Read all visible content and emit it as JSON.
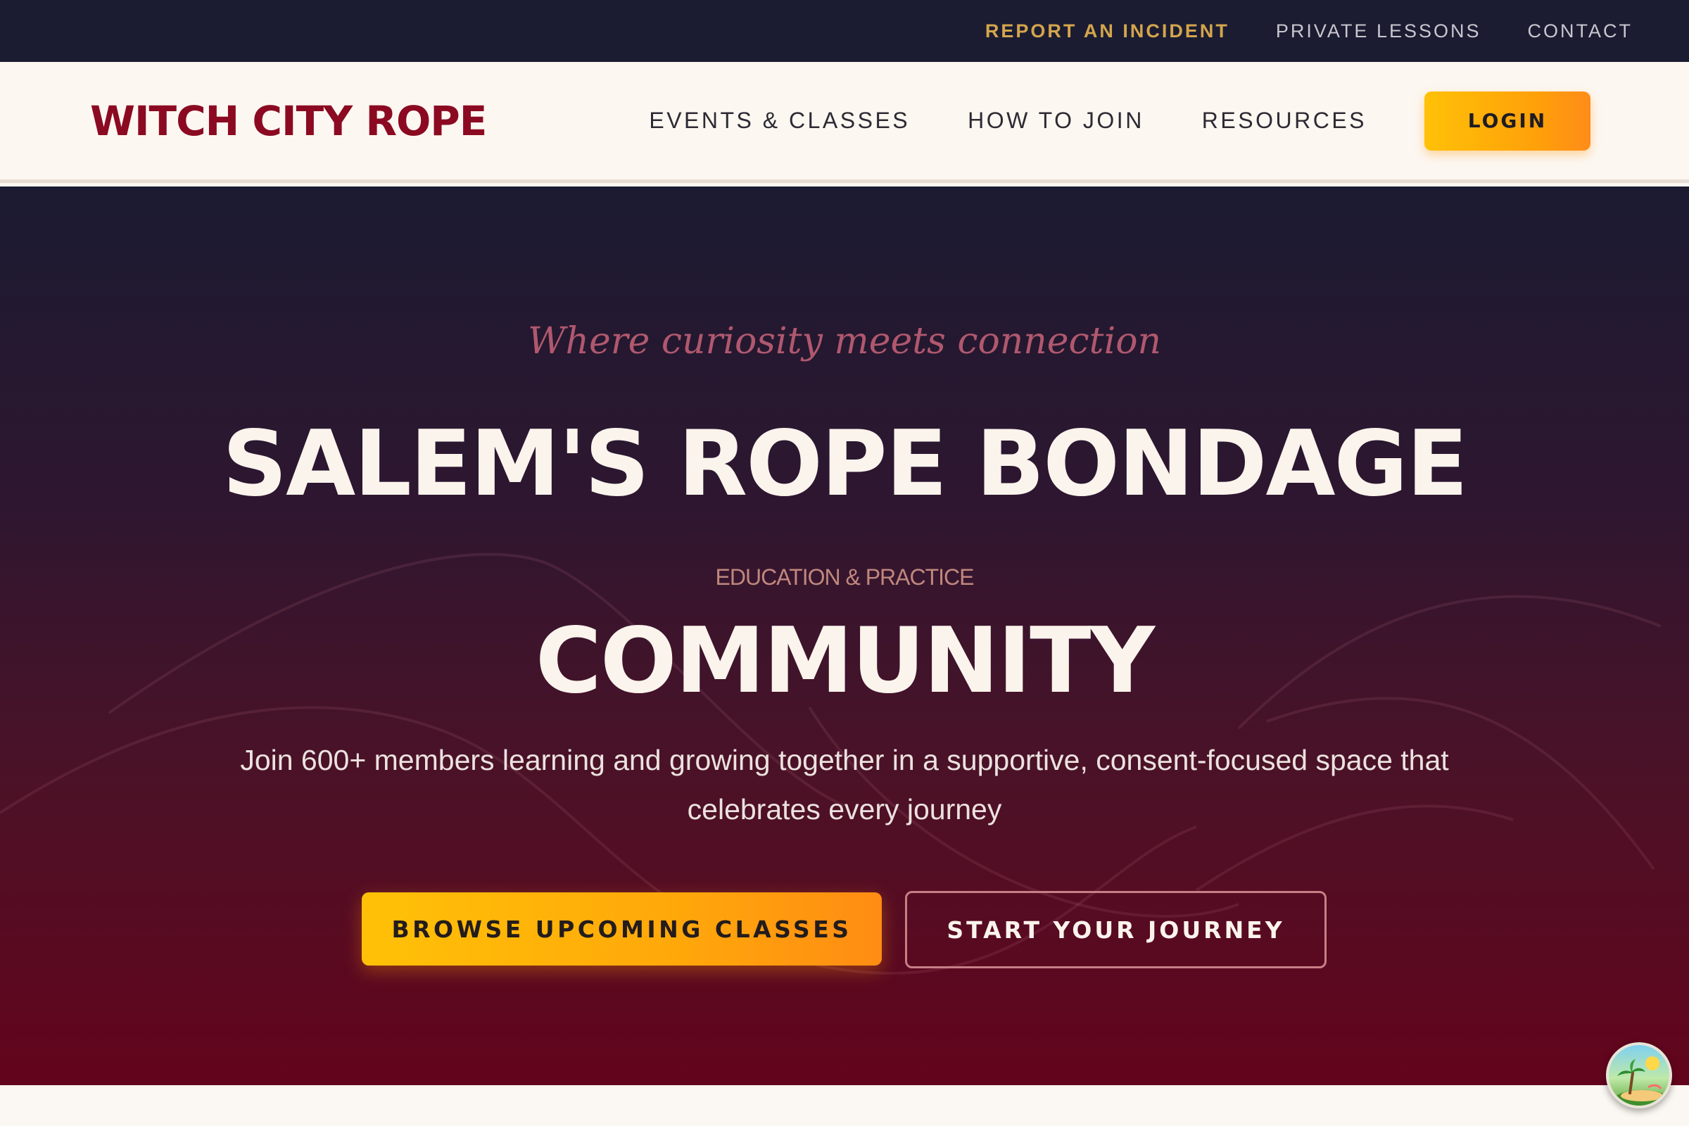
{
  "utility_nav": {
    "items": [
      {
        "label": "REPORT AN INCIDENT",
        "accent": true
      },
      {
        "label": "PRIVATE LESSONS",
        "accent": false
      },
      {
        "label": "CONTACT",
        "accent": false
      }
    ]
  },
  "header": {
    "logo": "WITCH CITY ROPE",
    "nav": [
      {
        "label": "EVENTS & CLASSES"
      },
      {
        "label": "HOW TO JOIN"
      },
      {
        "label": "RESOURCES"
      }
    ],
    "login_label": "LOGIN"
  },
  "hero": {
    "tagline": "Where curiosity meets connection",
    "title": "SALEM'S ROPE BONDAGE",
    "eyebrow": "EDUCATION & PRACTICE",
    "subtitle": "COMMUNITY",
    "description": "Join 600+ members learning and growing together in a supportive, consent-focused space that celebrates every journey",
    "cta_primary": "BROWSE UPCOMING CLASSES",
    "cta_secondary": "START YOUR JOURNEY"
  },
  "widget": {
    "icon": "island-icon"
  },
  "colors": {
    "brand": "#8b0a22",
    "accent_gold": "#d4a54d",
    "button_gradient_start": "#ffc107",
    "button_gradient_end": "#ff8c14",
    "utility_bar": "#1b1c31",
    "hero_top": "#1b1b31",
    "hero_bottom": "#63041c"
  }
}
